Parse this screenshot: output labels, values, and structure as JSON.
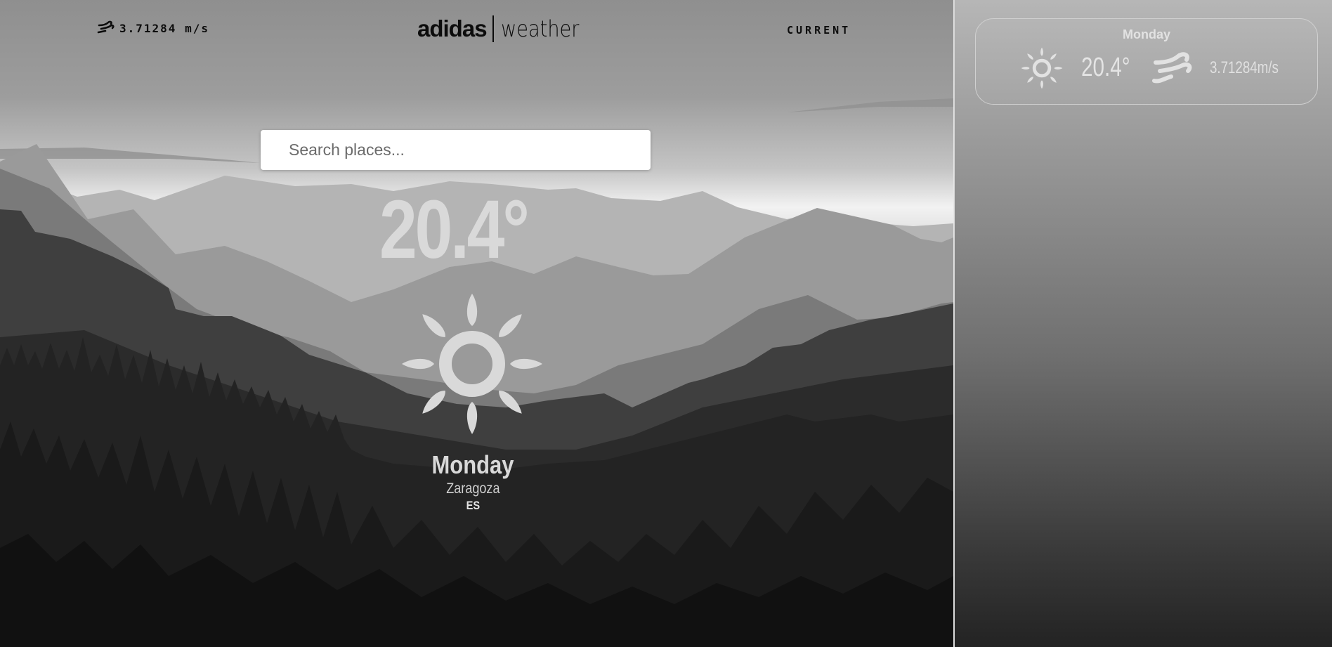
{
  "header": {
    "wind_icon": "wind-icon",
    "wind_speed": "3.71284 m/s",
    "brand_main": "adidas",
    "brand_sub": "weather",
    "nav_current": "CURRENT"
  },
  "search": {
    "placeholder": "Search places...",
    "value": ""
  },
  "current": {
    "temperature": "20.4°",
    "icon": "sun-icon",
    "day": "Monday",
    "city": "Zaragoza",
    "country": "ES"
  },
  "forecast": [
    {
      "day": "Monday",
      "icon": "sun-icon",
      "temperature": "20.4°",
      "wind_icon": "wind-icon",
      "wind_speed": "3.71284m/s"
    }
  ],
  "colors": {
    "text_dark": "#0c0c0c",
    "text_light": "#d9d9d9",
    "search_bg": "#ffffff"
  }
}
